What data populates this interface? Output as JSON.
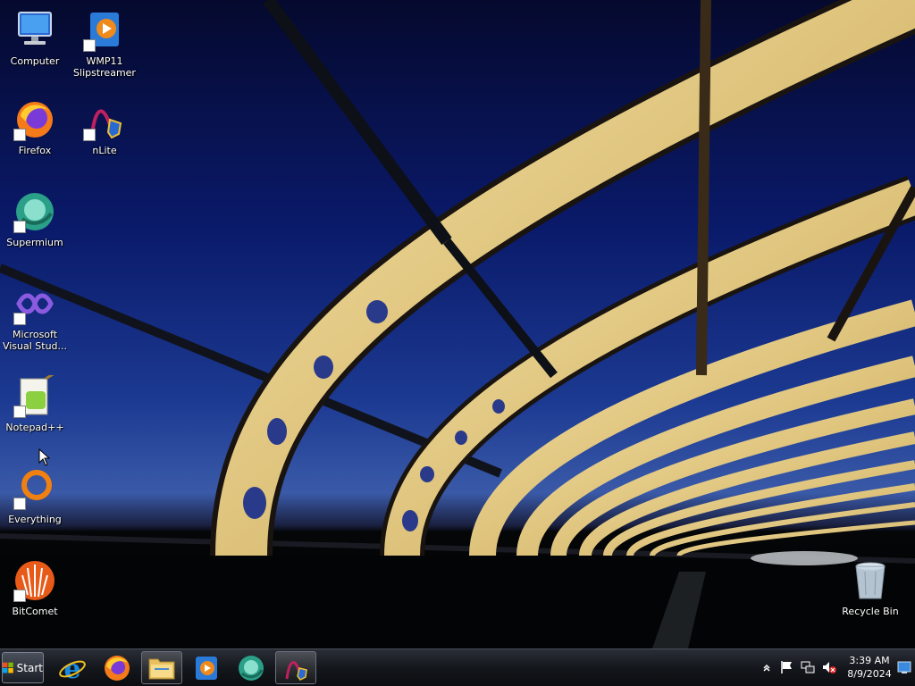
{
  "desktop": {
    "icons": [
      {
        "label": "Computer",
        "icon": "computer-icon"
      },
      {
        "label": "WMP11\nSlipstreamer",
        "icon": "wmp11-slipstreamer-icon"
      },
      {
        "label": "Firefox",
        "icon": "firefox-icon"
      },
      {
        "label": "nLite",
        "icon": "nlite-icon"
      },
      {
        "label": "Supermium",
        "icon": "supermium-icon"
      },
      {
        "label": "Microsoft\nVisual Stud...",
        "icon": "visual-studio-icon"
      },
      {
        "label": "Notepad++",
        "icon": "notepad-plus-plus-icon"
      },
      {
        "label": "Everything",
        "icon": "everything-icon"
      },
      {
        "label": "BitComet",
        "icon": "bitcomet-icon"
      },
      {
        "label": "Recycle Bin",
        "icon": "recycle-bin-icon"
      }
    ]
  },
  "taskbar": {
    "start_label": "Start",
    "pinned": [
      {
        "icon": "internet-explorer-icon"
      },
      {
        "icon": "firefox-icon"
      },
      {
        "icon": "file-explorer-icon",
        "active": true
      },
      {
        "icon": "windows-media-player-icon"
      },
      {
        "icon": "supermium-icon"
      },
      {
        "icon": "nlite-icon",
        "active": true
      }
    ],
    "tray": {
      "icons": [
        "show-hidden-icons-chevron-icon",
        "action-center-flag-icon",
        "network-icon",
        "volume-muted-icon"
      ],
      "time": "3:39 AM",
      "date": "8/9/2024"
    }
  },
  "colors": {
    "sky_top": "#05092e",
    "sky_mid": "#1c3a92",
    "bridge_gold": "#e8d08a",
    "taskbar": "#14171c"
  }
}
